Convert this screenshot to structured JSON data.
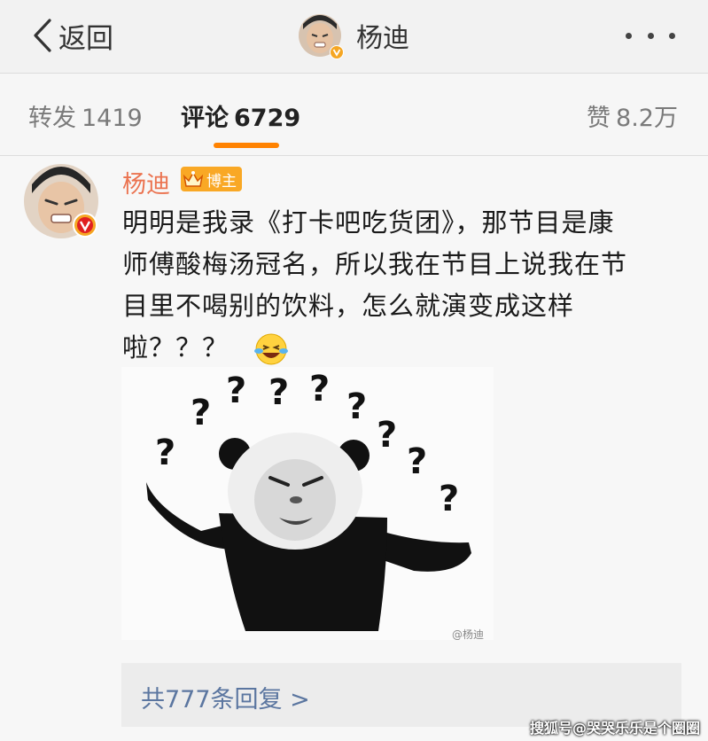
{
  "nav": {
    "back_label": "返回",
    "user_name": "杨迪"
  },
  "tabs": [
    {
      "label": "转发",
      "count": "1419",
      "active": false
    },
    {
      "label": "评论",
      "count": "6729",
      "active": true
    },
    {
      "label": "赞",
      "count": "8.2万",
      "active": false
    }
  ],
  "comment": {
    "author": "杨迪",
    "badge": "博主",
    "lines": [
      "明明是我录《打卡吧吃货团》，那节目是康",
      "师傅酸梅汤冠名，所以我在节目上说我在节",
      "目里不喝别的饮料，怎么就演变成这样",
      "啦？？？"
    ],
    "sticker_watermark": "@杨迪",
    "reply_summary": "共777条回复 >"
  },
  "source_watermark": "搜狐号@哭哭乐乐是个圈圈",
  "colors": {
    "accent": "#ff8200",
    "author_name": "#eb7350",
    "reply_link": "#5b76a0",
    "verified": "#f5a623"
  }
}
